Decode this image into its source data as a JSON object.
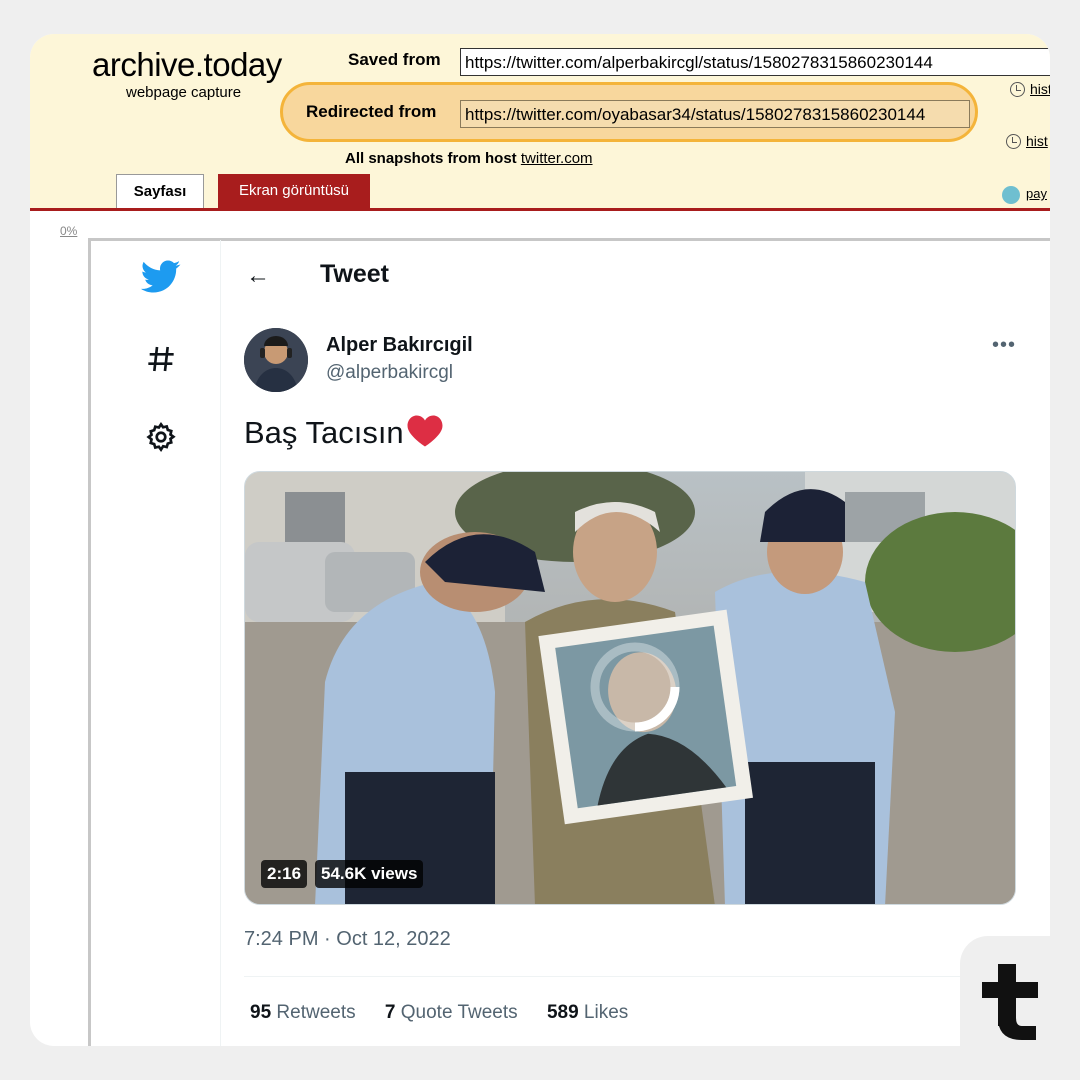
{
  "archive": {
    "logo": "archive.today",
    "subtitle": "webpage capture",
    "saved_label": "Saved from",
    "saved_url": "https://twitter.com/alperbakircgl/status/1580278315860230144",
    "redirected_label": "Redirected from",
    "redirected_url": "https://twitter.com/oyabasar34/status/1580278315860230144",
    "history_label": "hist",
    "snapshots_label": "All snapshots  from host",
    "snapshots_host": "twitter.com",
    "tab_page": "Sayfası",
    "tab_screenshot": "Ekran görüntüsü",
    "share_label": "pay",
    "percent": "0%"
  },
  "tweet": {
    "header_title": "Tweet",
    "back_icon": "←",
    "display_name": "Alper Bakırcıgil",
    "handle": "@alperbakircgl",
    "more": "•••",
    "text": "Baş Tacısın",
    "video_duration": "2:16",
    "video_views": "54.6K views",
    "timestamp": "7:24 PM · Oct 12, 2022",
    "retweets_count": "95",
    "retweets_label": "Retweets",
    "quotes_count": "7",
    "quotes_label": "Quote Tweets",
    "likes_count": "589",
    "likes_label": "Likes"
  },
  "colors": {
    "archive_bg": "#fdf6d8",
    "archive_red": "#a81d1d",
    "highlight": "#f4b43a",
    "twitter_blue": "#1d9bf0",
    "heart": "#dd2e44"
  }
}
